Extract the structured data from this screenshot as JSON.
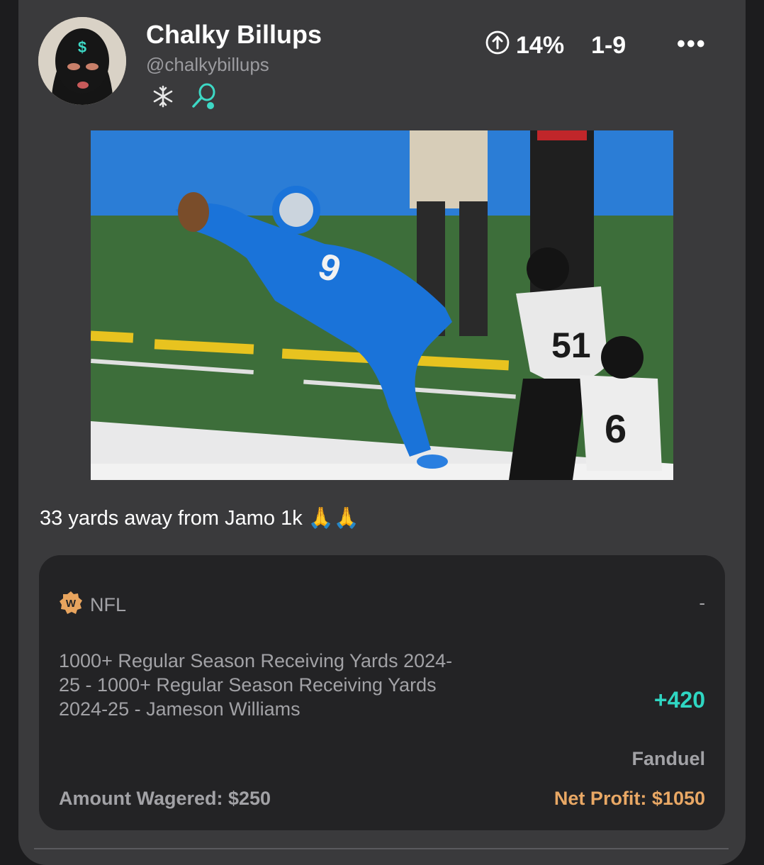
{
  "post": {
    "user": {
      "name": "Chalky Billups",
      "handle": "@chalkybillups",
      "badges": [
        "snowflake-icon",
        "tennis-racket-icon"
      ]
    },
    "stats": {
      "roi": "14%",
      "record": "1-9"
    },
    "more_label": "•••",
    "caption": "33 yards away from Jamo 1k 🙏🙏"
  },
  "bet": {
    "league": "NFL",
    "league_logo_letter": "W",
    "status": "-",
    "description": "1000+ Regular Season Receiving Yards 2024-25 - 1000+ Regular Season Receiving Yards 2024-25 - Jameson Williams",
    "odds": "+420",
    "sportsbook": "Fanduel",
    "amount_wagered": "Amount Wagered: $250",
    "net_profit": "Net Profit: $1050"
  },
  "colors": {
    "card_bg": "#3a3a3c",
    "bet_bg": "#232325",
    "odds": "#2fd6c2",
    "profit": "#e9a865",
    "muted_text": "#a2a2a6",
    "badge_teal": "#3dd8c5"
  }
}
